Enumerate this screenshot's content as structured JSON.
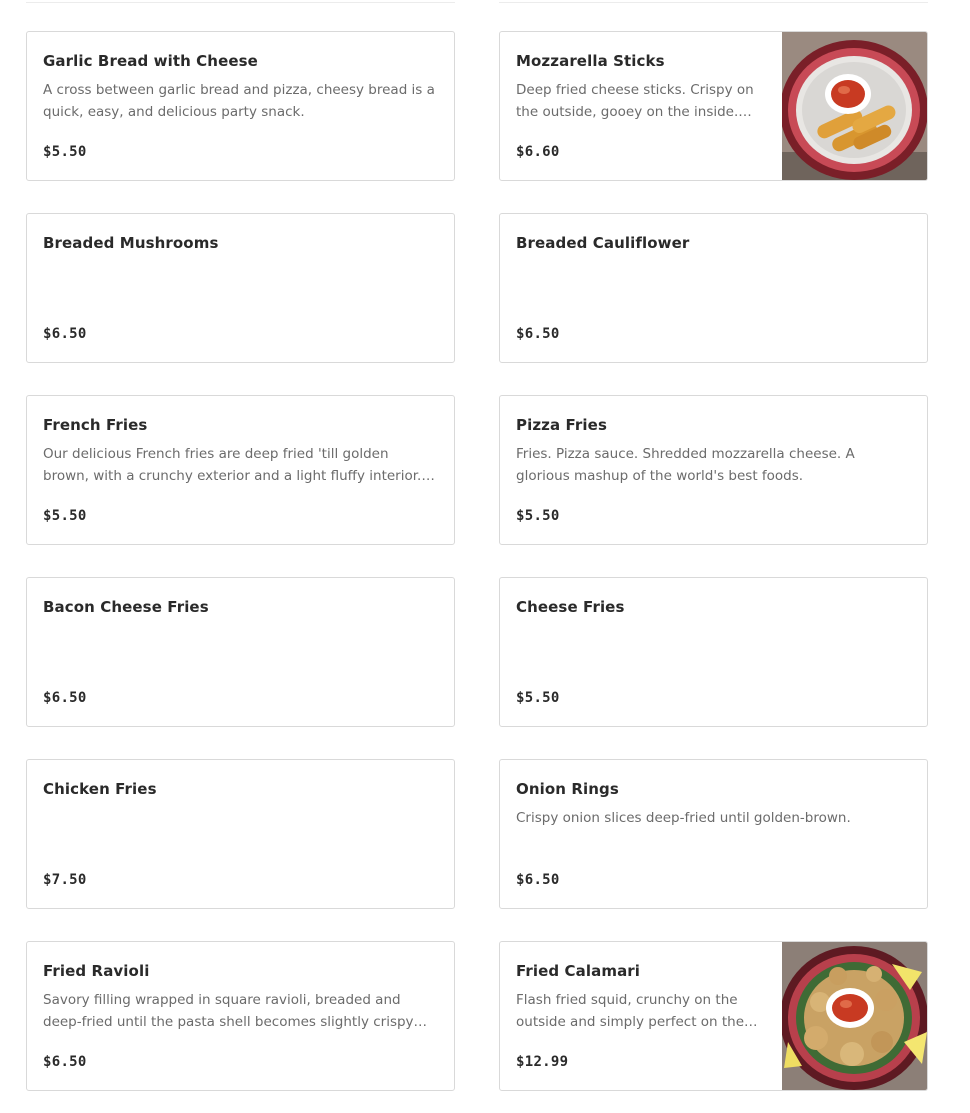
{
  "menu": {
    "items": [
      {
        "name": "Garlic Bread with Cheese",
        "description": "A cross between garlic bread and pizza, cheesy bread is a quick, easy, and delicious party snack.",
        "price": "$5.50"
      },
      {
        "name": "Mozzarella Sticks",
        "description": "Deep fried cheese sticks. Crispy on the outside, gooey on the inside. Virtually…",
        "price": "$6.60",
        "image": "mozzarella-sticks-photo"
      },
      {
        "name": "Breaded Mushrooms",
        "description": "",
        "price": "$6.50"
      },
      {
        "name": "Breaded Cauliflower",
        "description": "",
        "price": "$6.50"
      },
      {
        "name": "French Fries",
        "description": "Our delicious French fries are deep fried 'till golden brown, with a crunchy exterior and a light fluffy interior. Seasoned t…",
        "price": "$5.50"
      },
      {
        "name": "Pizza Fries",
        "description": "Fries. Pizza sauce. Shredded mozzarella cheese. A glorious mashup of the world's best foods.",
        "price": "$5.50"
      },
      {
        "name": "Bacon Cheese Fries",
        "description": "",
        "price": "$6.50"
      },
      {
        "name": "Cheese Fries",
        "description": "",
        "price": "$5.50"
      },
      {
        "name": "Chicken Fries",
        "description": "",
        "price": "$7.50"
      },
      {
        "name": "Onion Rings",
        "description": "Crispy onion slices deep-fried until golden-brown.",
        "price": "$6.50"
      },
      {
        "name": "Fried Ravioli",
        "description": "Savory filling wrapped in square ravioli, breaded and deep-fried until the pasta shell becomes slightly crispy and golden…",
        "price": "$6.50"
      },
      {
        "name": "Fried Calamari",
        "description": "Flash fried squid, crunchy on the outside and simply perfect on the…",
        "price": "$12.99",
        "image": "fried-calamari-photo"
      }
    ]
  }
}
